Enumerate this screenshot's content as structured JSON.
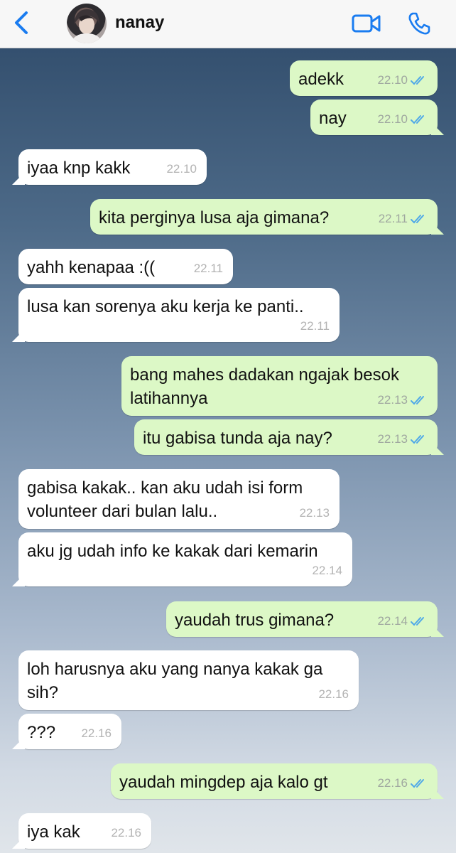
{
  "header": {
    "contact_name": "nanay"
  },
  "messages": [
    {
      "text": "adekk",
      "time": "22.10"
    },
    {
      "text": "nay",
      "time": "22.10"
    },
    {
      "text": "iyaa knp kakk",
      "time": "22.10"
    },
    {
      "text": "kita perginya lusa aja gimana?",
      "time": "22.11"
    },
    {
      "text": "yahh kenapaa :((",
      "time": "22.11"
    },
    {
      "text": "lusa kan sorenya aku kerja ke panti..",
      "time": "22.11"
    },
    {
      "text": "bang mahes dadakan ngajak besok latihannya",
      "time": "22.13"
    },
    {
      "text": "itu gabisa tunda aja nay?",
      "time": "22.13"
    },
    {
      "text": "gabisa kakak.. kan aku udah isi form volunteer dari bulan lalu..",
      "time": "22.13"
    },
    {
      "text": "aku jg udah info ke kakak dari kemarin",
      "time": "22.14"
    },
    {
      "text": "yaudah trus gimana?",
      "time": "22.14"
    },
    {
      "text": "loh harusnya aku yang nanya kakak ga sih?",
      "time": "22.16"
    },
    {
      "text": "???",
      "time": "22.16"
    },
    {
      "text": "yaudah mingdep aja kalo gt",
      "time": "22.16"
    },
    {
      "text": "iya kak",
      "time": "22.16"
    }
  ],
  "colors": {
    "accent": "#1a7cf0",
    "outgoing_bubble": "#dcf8c6",
    "incoming_bubble": "#ffffff",
    "read_ticks": "#4fa8e8"
  },
  "icons": {
    "back": "chevron-left-icon",
    "video": "video-camera-icon",
    "call": "phone-icon",
    "read": "double-check-icon"
  }
}
